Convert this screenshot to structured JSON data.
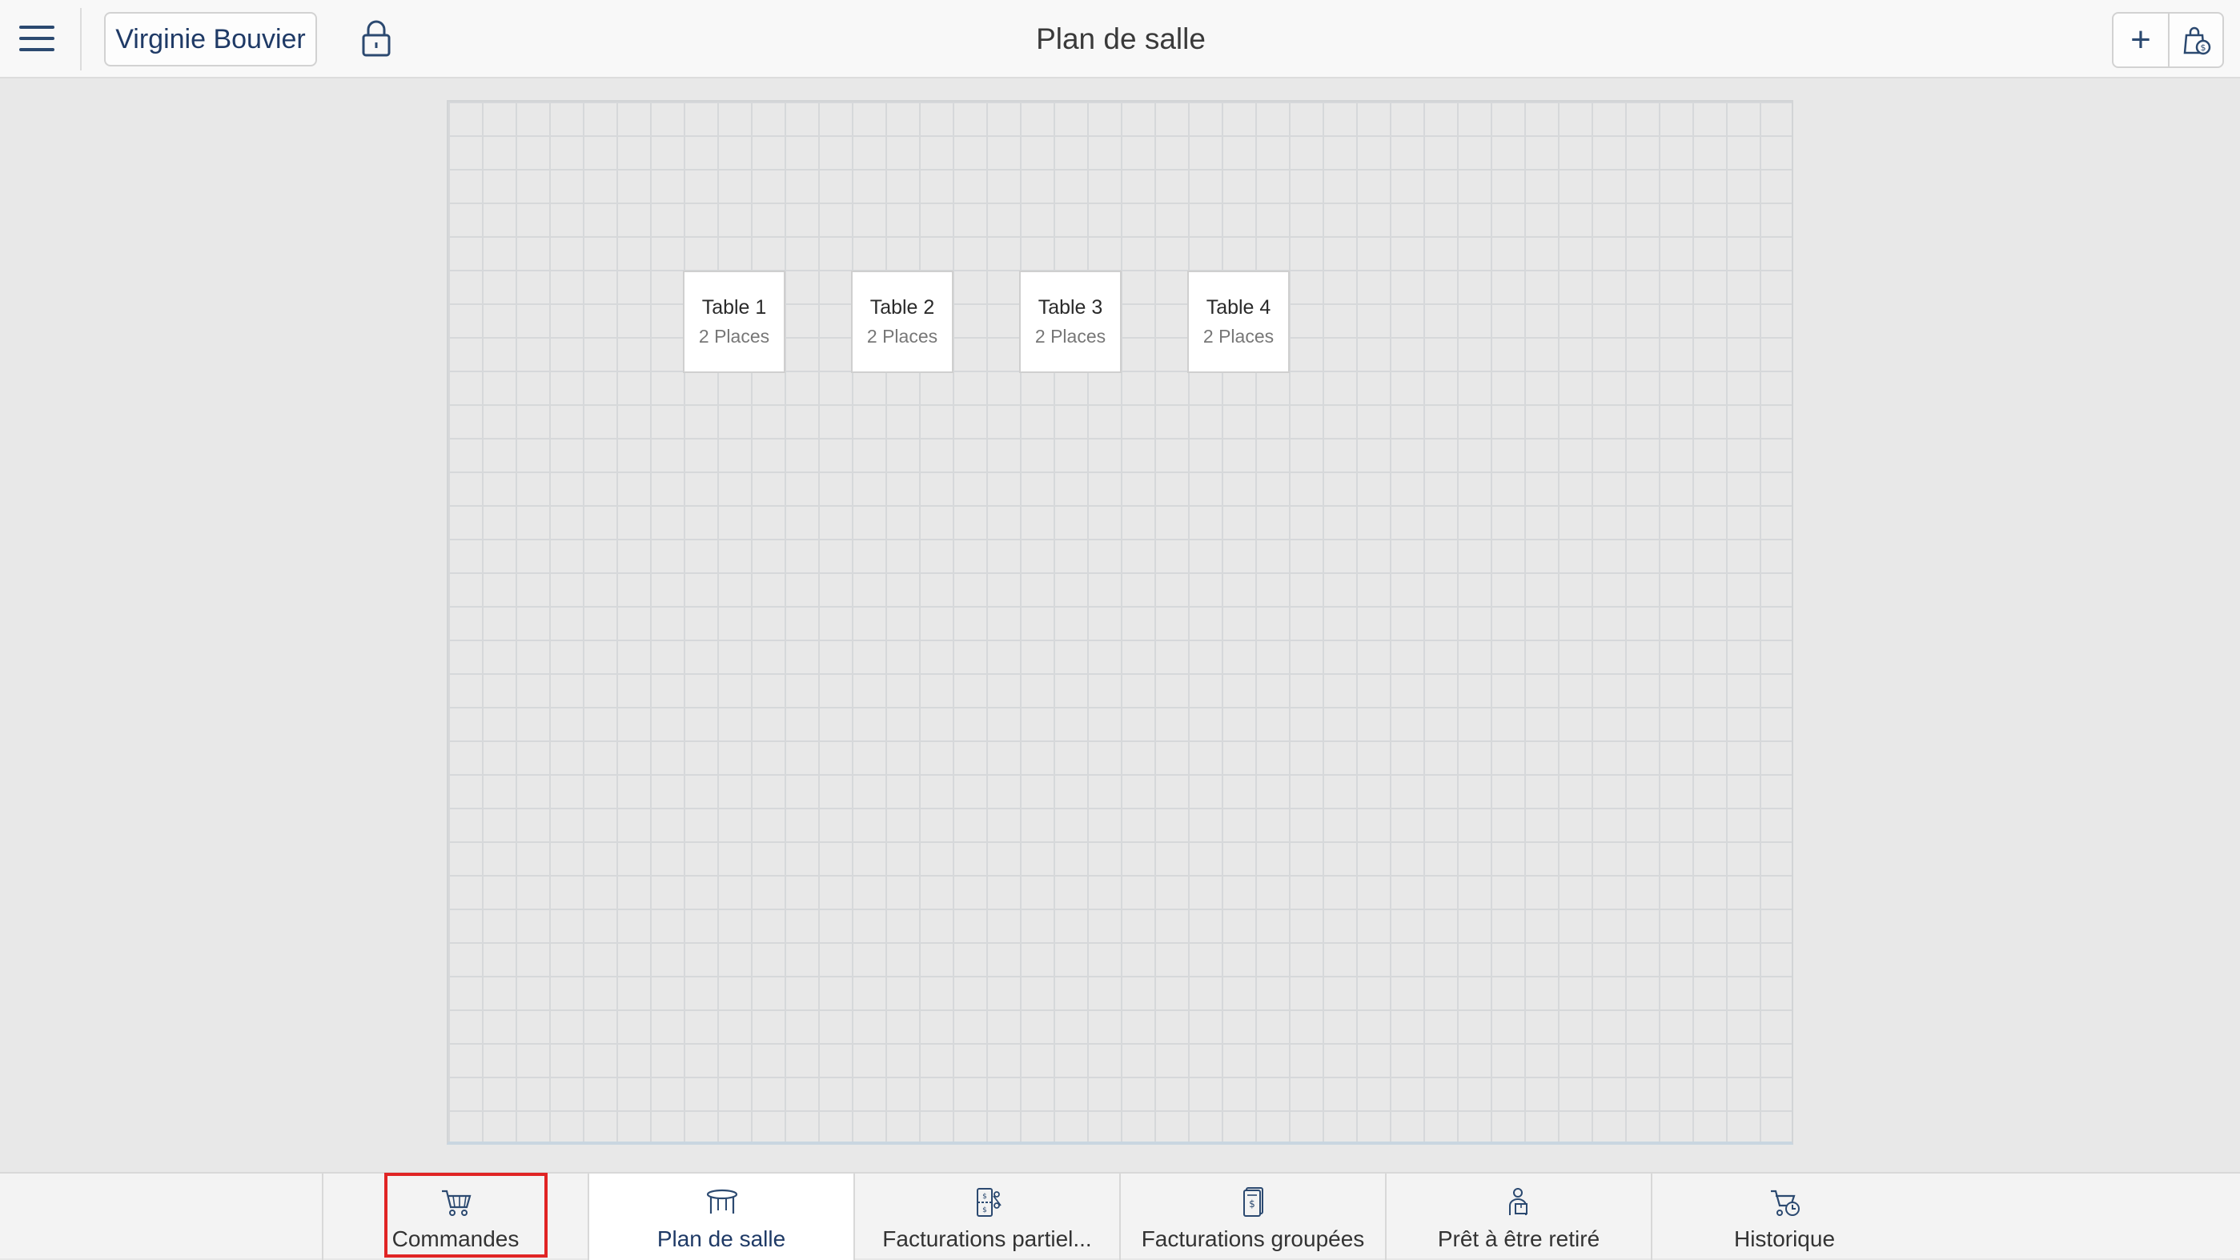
{
  "header": {
    "user_name": "Virginie Bouvier",
    "title": "Plan de salle",
    "add_label": "+",
    "icons": [
      "menu-icon",
      "lock-icon",
      "plus-icon",
      "shopping-bag-money-icon"
    ]
  },
  "floor_plan": {
    "tables": [
      {
        "name": "Table 1",
        "places": "2 Places"
      },
      {
        "name": "Table 2",
        "places": "2 Places"
      },
      {
        "name": "Table 3",
        "places": "2 Places"
      },
      {
        "name": "Table 4",
        "places": "2 Places"
      }
    ]
  },
  "tabs": [
    {
      "label": "Commandes",
      "icon": "cart-icon"
    },
    {
      "label": "Plan de salle",
      "icon": "table-icon",
      "active": true
    },
    {
      "label": "Facturations partiel...",
      "icon": "split-bill-icon"
    },
    {
      "label": "Facturations groupées",
      "icon": "grouped-bill-icon"
    },
    {
      "label": "Prêt à être retiré",
      "icon": "pickup-icon"
    },
    {
      "label": "Historique",
      "icon": "cart-history-icon"
    }
  ],
  "colors": {
    "accent": "#1f3a66",
    "highlight": "#e02424",
    "background": "#e8e8e8"
  }
}
